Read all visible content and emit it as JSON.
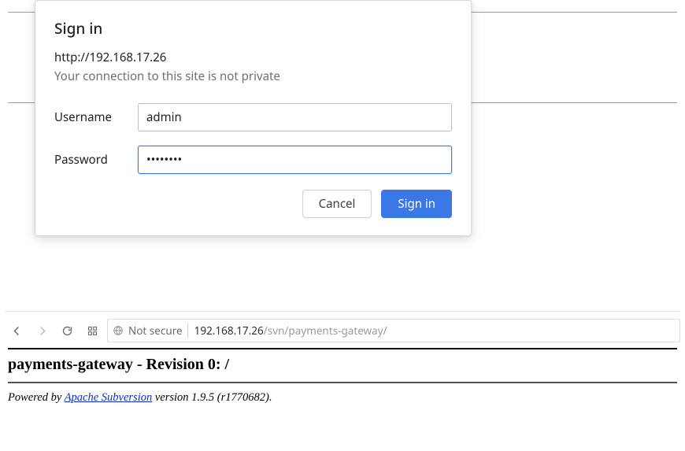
{
  "dialog": {
    "title": "Sign in",
    "origin": "http://192.168.17.26",
    "warning": "Your connection to this site is not private",
    "username_label": "Username",
    "username_value": "admin",
    "password_label": "Password",
    "password_value": "••••••••",
    "cancel_label": "Cancel",
    "signin_label": "Sign in"
  },
  "browser_bar": {
    "security_label": "Not secure",
    "url_host": "192.168.17.26",
    "url_path": "/svn/payments-gateway/"
  },
  "repo": {
    "heading": "payments-gateway - Revision 0: /",
    "footer_prefix": "Powered by ",
    "footer_link": "Apache Subversion",
    "footer_suffix": " version 1.9.5 (r1770682)."
  }
}
